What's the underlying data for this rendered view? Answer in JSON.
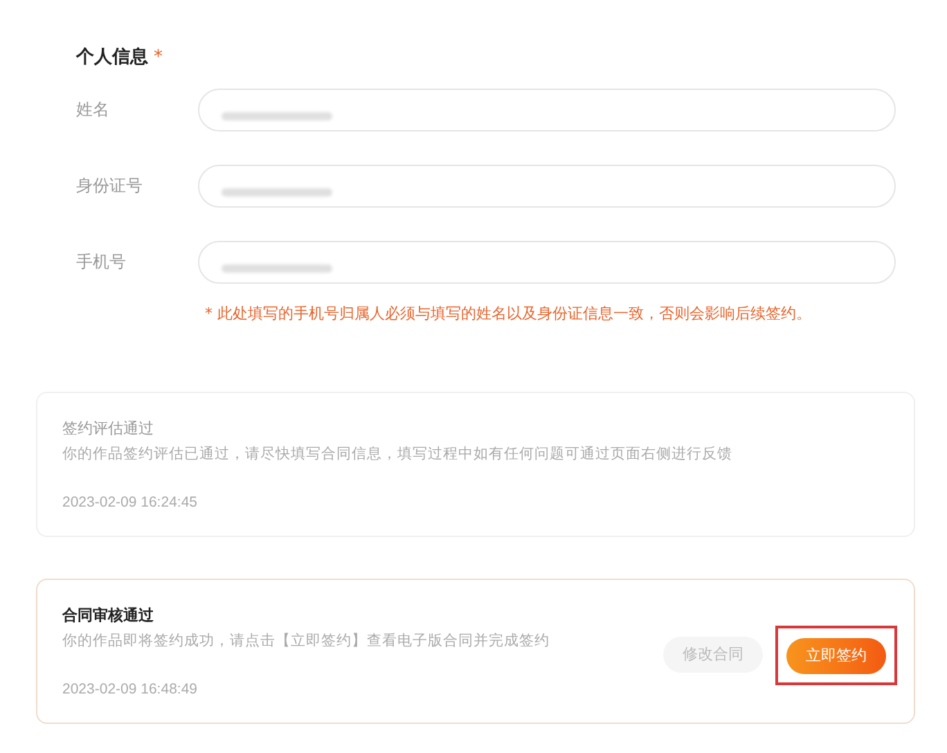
{
  "section": {
    "title": "个人信息",
    "required_mark": "*"
  },
  "fields": [
    {
      "label": "姓名",
      "redacted": true
    },
    {
      "label": "身份证号",
      "redacted": true
    },
    {
      "label": "手机号",
      "redacted": true
    }
  ],
  "note": "* 此处填写的手机号归属人必须与填写的姓名以及身份证信息一致，否则会影响后续签约。",
  "status_cards": [
    {
      "title": "签约评估通过",
      "message": "你的作品签约评估已通过，请尽快填写合同信息，填写过程中如有任何问题可通过页面右侧进行反馈",
      "time": "2023-02-09 16:24:45",
      "active": false
    },
    {
      "title": "合同审核通过",
      "message": "你的作品即将签约成功，请点击【立即签约】查看电子版合同并完成签约",
      "time": "2023-02-09 16:48:49",
      "active": true,
      "buttons": [
        {
          "label": "修改合同",
          "kind": "secondary",
          "highlighted": false
        },
        {
          "label": "立即签约",
          "kind": "primary",
          "highlighted": true
        }
      ]
    }
  ]
}
